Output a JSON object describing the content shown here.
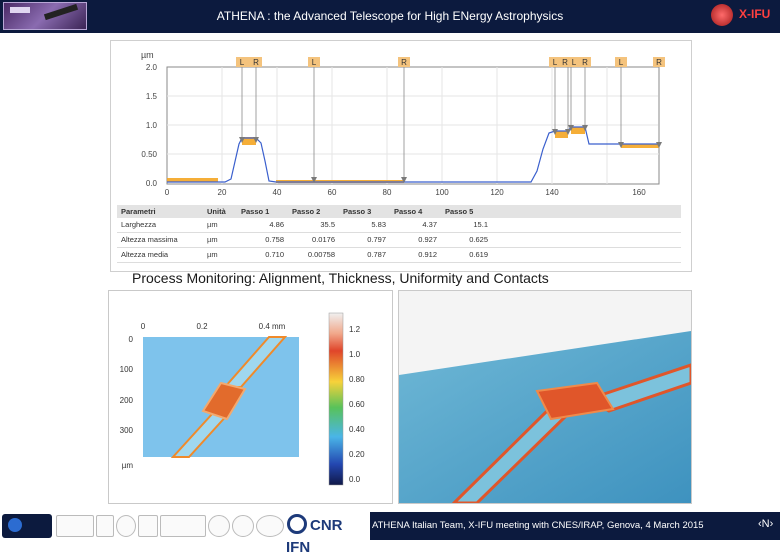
{
  "header": {
    "title": "ATHENA : the Advanced Telescope for High ENergy Astrophysics",
    "logo_text": "X-IFU"
  },
  "profile_chart": {
    "unit_label": "µm",
    "y_ticks": [
      "2.0",
      "1.5",
      "1.0",
      "0.50",
      "0.0"
    ],
    "x_ticks": [
      "0",
      "20",
      "40",
      "60",
      "80",
      "100",
      "120",
      "140",
      "160",
      "180 µm"
    ],
    "markers": [
      "L",
      "R",
      "L",
      "R",
      "L",
      "R",
      "L",
      "R",
      "L",
      "R"
    ],
    "table": {
      "headers": [
        "Parametri",
        "Unità",
        "Passo 1",
        "Passo 2",
        "Passo 3",
        "Passo 4",
        "Passo 5"
      ],
      "rows": [
        [
          "Larghezza",
          "µm",
          "4.86",
          "35.5",
          "5.83",
          "4.37",
          "15.1"
        ],
        [
          "Altezza massima",
          "µm",
          "0.758",
          "0.0176",
          "0.797",
          "0.927",
          "0.625"
        ],
        [
          "Altezza media",
          "µm",
          "0.710",
          "0.00758",
          "0.787",
          "0.912",
          "0.619"
        ]
      ]
    }
  },
  "caption": "Process Monitoring: Alignment, Thickness, Uniformity and Contacts",
  "map2d": {
    "x_ticks": [
      "0",
      "0.2",
      "0.4 mm"
    ],
    "y_ticks": [
      "0",
      "100",
      "200",
      "300",
      "µm"
    ],
    "colorbar_ticks": [
      "1.2",
      "1.0",
      "0.80",
      "0.60",
      "0.40",
      "0.20",
      "0.0"
    ]
  },
  "footer": {
    "cnr_label": "CNR IFN",
    "text": "ATHENA Italian Team, X-IFU meeting with CNES/IRAP, Genova, 4 March 2015",
    "page": "‹N›"
  }
}
